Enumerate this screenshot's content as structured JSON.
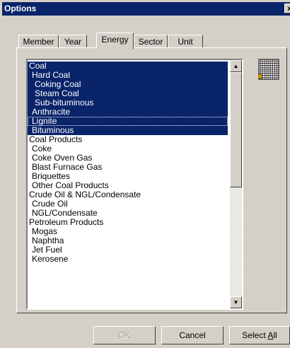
{
  "window": {
    "title": "Options",
    "close_glyph": "x"
  },
  "tabs": [
    {
      "label": "Member",
      "active": false
    },
    {
      "label": "Year",
      "active": false
    },
    {
      "label": "Energy",
      "active": true
    },
    {
      "label": "Sector",
      "active": false
    },
    {
      "label": "Unit",
      "active": false
    }
  ],
  "list": {
    "items": [
      {
        "label": "Coal",
        "indent": 0,
        "selected": true
      },
      {
        "label": "Hard Coal",
        "indent": 1,
        "selected": true
      },
      {
        "label": "Coking Coal",
        "indent": 2,
        "selected": true
      },
      {
        "label": "Steam Coal",
        "indent": 2,
        "selected": true
      },
      {
        "label": "Sub-bituminous",
        "indent": 2,
        "selected": true
      },
      {
        "label": "Anthracite",
        "indent": 1,
        "selected": true
      },
      {
        "label": "Lignite",
        "indent": 1,
        "selected": true,
        "focused": true
      },
      {
        "label": "Bituminous",
        "indent": 1,
        "selected": true
      },
      {
        "label": "Coal Products",
        "indent": 0,
        "selected": false
      },
      {
        "label": "Coke",
        "indent": 1,
        "selected": false
      },
      {
        "label": "Coke Oven Gas",
        "indent": 1,
        "selected": false
      },
      {
        "label": "Blast Furnace Gas",
        "indent": 1,
        "selected": false
      },
      {
        "label": "Briquettes",
        "indent": 1,
        "selected": false
      },
      {
        "label": "Other Coal Products",
        "indent": 1,
        "selected": false
      },
      {
        "label": "Crude Oil & NGL/Condensate",
        "indent": 0,
        "selected": false
      },
      {
        "label": "Crude Oil",
        "indent": 1,
        "selected": false
      },
      {
        "label": "NGL/Condensate",
        "indent": 1,
        "selected": false
      },
      {
        "label": "Petroleum Products",
        "indent": 0,
        "selected": false
      },
      {
        "label": "Mogas",
        "indent": 1,
        "selected": false
      },
      {
        "label": "Naphtha",
        "indent": 1,
        "selected": false
      },
      {
        "label": "Jet Fuel",
        "indent": 1,
        "selected": false
      },
      {
        "label": "Kerosene",
        "indent": 1,
        "selected": false
      }
    ],
    "scroll_up_glyph": "▲",
    "scroll_down_glyph": "▼"
  },
  "buttons": {
    "ok": "OK",
    "cancel": "Cancel",
    "select_all_prefix": "Select ",
    "select_all_mnemonic": "A",
    "select_all_suffix": "ll"
  },
  "colors": {
    "titlebar": "#0a246a",
    "selection": "#0a246a",
    "face": "#d4d0c8",
    "grid_marker": "#d8a000"
  }
}
